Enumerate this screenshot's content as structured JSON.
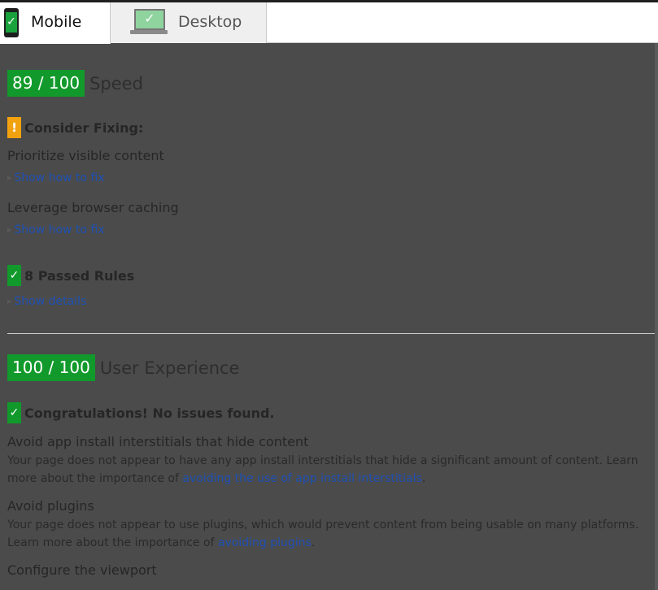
{
  "tabs": {
    "mobile": {
      "label": "Mobile",
      "icon": "mobile-phone-check-icon",
      "check": "✓"
    },
    "desktop": {
      "label": "Desktop",
      "icon": "desktop-monitor-check-icon",
      "check": "✓"
    }
  },
  "speed": {
    "score": "89 / 100",
    "label": "Speed",
    "consider_heading": "Consider Fixing:",
    "warning_glyph": "!",
    "rules": [
      {
        "title": "Prioritize visible content",
        "link": "Show how to fix"
      },
      {
        "title": "Leverage browser caching",
        "link": "Show how to fix"
      }
    ],
    "passed_heading": "8 Passed Rules",
    "passed_check": "✓",
    "passed_link": "Show details"
  },
  "ux": {
    "score": "100 / 100",
    "label": "User Experience",
    "congrats_heading": "Congratulations! No issues found.",
    "congrats_check": "✓",
    "items": [
      {
        "title": "Avoid app install interstitials that hide content",
        "desc_before": "Your page does not appear to have any app install interstitials that hide a significant amount of content. Learn more about the importance of ",
        "link": "avoiding the use of app install interstitials",
        "desc_after": "."
      },
      {
        "title": "Avoid plugins",
        "desc_before": "Your page does not appear to use plugins, which would prevent content from being usable on many platforms. Learn more about the importance of ",
        "link": "avoiding plugins",
        "desc_after": "."
      },
      {
        "title": "Configure the viewport"
      }
    ]
  },
  "colors": {
    "score_green": "#119a2b",
    "warning_orange": "#f2a20f",
    "link_blue": "#1e50b4",
    "overlay": "#4b4b4b"
  }
}
